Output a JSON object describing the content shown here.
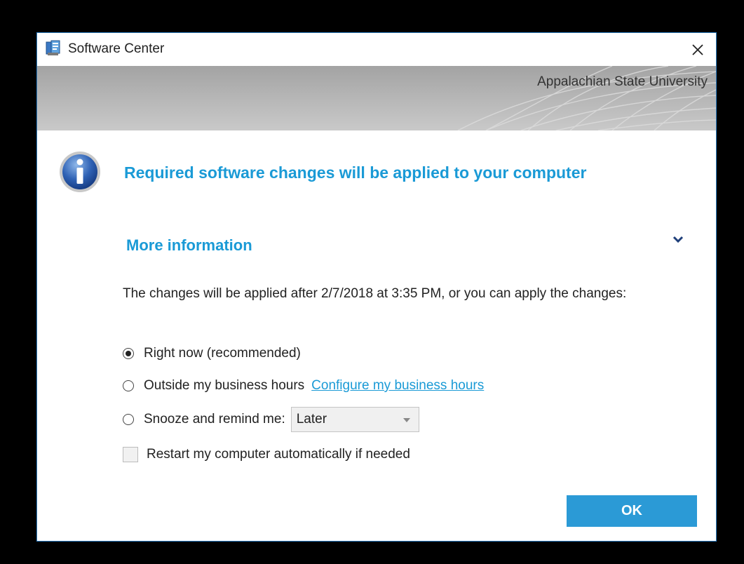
{
  "window": {
    "title": "Software Center",
    "close_symbol": "✕"
  },
  "banner": {
    "organization": "Appalachian State University"
  },
  "message": {
    "icon": "info-icon",
    "headline": "Required software changes will be applied to your computer"
  },
  "details": {
    "more_information_label": "More information",
    "expander_icon": "chevron-down-icon",
    "description": "The changes will be applied after 2/7/2018 at 3:35 PM, or you can apply the changes:"
  },
  "options": {
    "right_now": {
      "label": "Right now (recommended)",
      "selected": true
    },
    "outside_hours": {
      "label": "Outside my business hours",
      "selected": false,
      "link": "Configure my business hours"
    },
    "snooze": {
      "label": "Snooze and remind me:",
      "selected": false,
      "dropdown_value": "Later"
    },
    "restart": {
      "label": "Restart my computer automatically if needed",
      "checked": false
    }
  },
  "buttons": {
    "ok_label": "OK"
  },
  "colors": {
    "accent": "#1a9ad6",
    "ok_button": "#2b9ad6",
    "window_border": "#2b7bc0"
  }
}
